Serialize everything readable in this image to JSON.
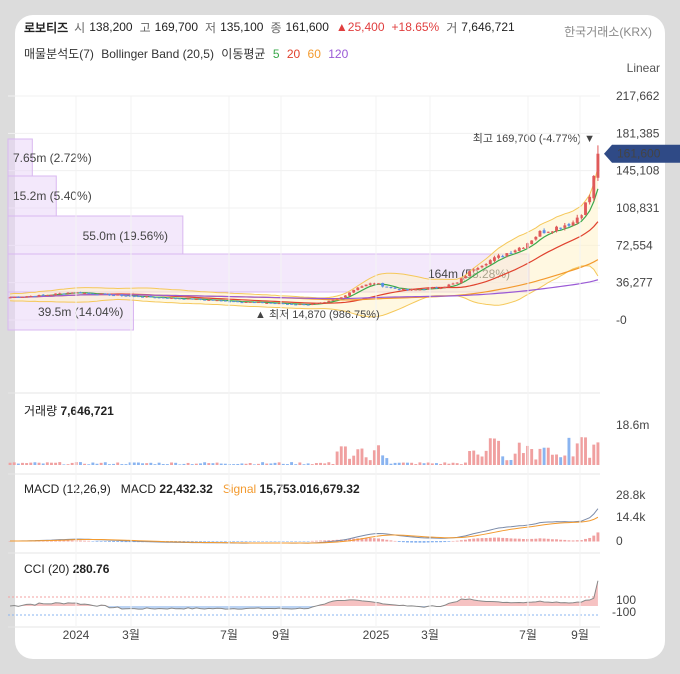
{
  "header": {
    "name": "로보티즈",
    "open_label": "시",
    "open": "138,200",
    "high_label": "고",
    "high": "169,700",
    "low_label": "저",
    "low": "135,100",
    "close_label": "종",
    "close": "161,600",
    "change": "▲25,400",
    "change_pct": "+18.65%",
    "volume_label": "거",
    "volume": "7,646,721",
    "exchange": "한국거래소(KRX)"
  },
  "indicators": {
    "volume_profile": "매물분석도(7)",
    "bollinger": "Bollinger Band (20,5)",
    "ma_label": "이동평균",
    "ma5": "5",
    "ma20": "20",
    "ma60": "60",
    "ma120": "120"
  },
  "scale_mode": "Linear",
  "colors": {
    "up": "#e05a5a",
    "down": "#5b8ee6",
    "bollinger": "#f5c85a",
    "ma5": "#3aa84a",
    "ma20": "#e0422e",
    "ma60": "#f39a2e",
    "ma120": "#9a5ad6",
    "profile": "#ead6f7",
    "price_tag": "#2f4a86"
  },
  "chart_data": {
    "type": "candlestick",
    "y_ticks": [
      "217,662",
      "181,385",
      "145,108",
      "108,831",
      "72,554",
      "36,277",
      "0"
    ],
    "x_ticks": [
      "2024",
      "3월",
      "7월",
      "9월",
      "2025",
      "3월",
      "7월",
      "9월"
    ],
    "last_price_tag": "161,600",
    "max_annotation": "최고 169,700 (-4.77%)",
    "min_annotation": "최저 14,870 (986.75%)",
    "volume_profile": [
      {
        "label": "7.65m (2.72%)",
        "share": 2.72
      },
      {
        "label": "15.2m (5.40%)",
        "share": 5.4
      },
      {
        "label": "55.0m (19.56%)",
        "share": 19.56
      },
      {
        "label": "164m (58.28%)",
        "share": 58.28
      },
      {
        "label": "39.5m (14.04%)",
        "share": 14.04
      }
    ],
    "price_keypoints": [
      [
        0,
        22000
      ],
      [
        8,
        24000
      ],
      [
        15,
        27000
      ],
      [
        22,
        25000
      ],
      [
        30,
        23000
      ],
      [
        40,
        21000
      ],
      [
        50,
        19000
      ],
      [
        60,
        17000
      ],
      [
        68,
        15500
      ],
      [
        72,
        15000
      ],
      [
        76,
        17000
      ],
      [
        80,
        22000
      ],
      [
        84,
        32000
      ],
      [
        88,
        36000
      ],
      [
        92,
        31000
      ],
      [
        96,
        29000
      ],
      [
        100,
        30000
      ],
      [
        104,
        32000
      ],
      [
        108,
        36000
      ],
      [
        112,
        50000
      ],
      [
        116,
        58000
      ],
      [
        120,
        65000
      ],
      [
        124,
        72000
      ],
      [
        128,
        85000
      ],
      [
        132,
        90000
      ],
      [
        136,
        95000
      ],
      [
        138,
        105000
      ],
      [
        140,
        120000
      ],
      [
        141,
        138000
      ],
      [
        142,
        161600
      ]
    ]
  },
  "volume_panel": {
    "label": "거래량",
    "value": "7,646,721",
    "tick": "18.6m"
  },
  "macd_panel": {
    "label": "MACD (12,26,9)",
    "macd_label": "MACD",
    "macd_value": "22,432.32",
    "signal_label": "Signal",
    "signal_value": "15,753.016,679.32",
    "ticks": [
      "28.8k",
      "14.4k",
      "0"
    ]
  },
  "cci_panel": {
    "label": "CCI (20)",
    "value": "280.76",
    "ticks": [
      "100",
      "-100"
    ]
  }
}
